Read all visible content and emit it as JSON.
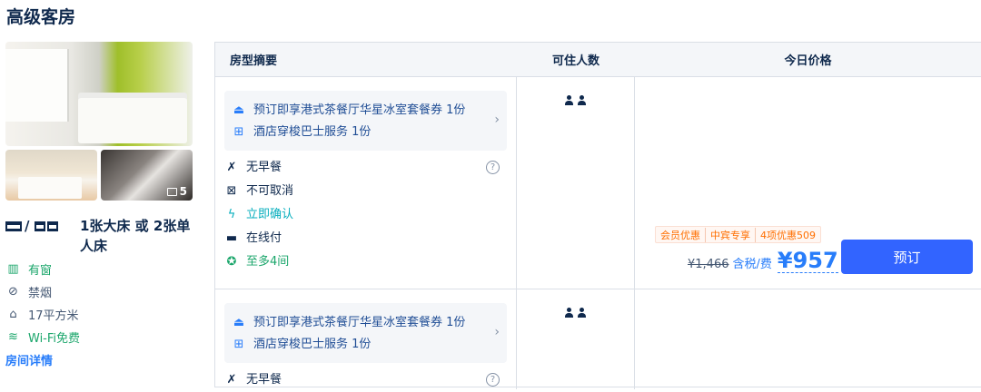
{
  "room": {
    "title": "高级客房",
    "photo_count": "5",
    "bed_sep": "/",
    "bed_text": "1张大床 或 2张单人床",
    "attributes": [
      {
        "icon": "window-icon",
        "text": "有窗"
      },
      {
        "icon": "no-smoking-icon",
        "text": "禁烟"
      },
      {
        "icon": "area-icon",
        "text": "17平方米"
      },
      {
        "icon": "wifi-icon",
        "text": "Wi-Fi免费"
      }
    ],
    "detail_link": "房间详情"
  },
  "table": {
    "headers": [
      "房型摘要",
      "可住人数",
      "今日价格"
    ]
  },
  "rows": [
    {
      "package": [
        "预订即享港式茶餐厅华星冰室套餐券 1份",
        "酒店穿梭巴士服务 1份"
      ],
      "features": [
        "无早餐",
        "不可取消",
        "立即确认",
        "在线付",
        "至多4间"
      ],
      "promo_tags": [
        "会员优惠",
        "中宾专享",
        "4项优惠509"
      ],
      "old_price": "¥1,466",
      "tax_label": "含税/费",
      "price": "¥957",
      "book_label": "预订"
    },
    {
      "package": [
        "预订即享港式茶餐厅华星冰室套餐券 1份",
        "酒店穿梭巴士服务 1份"
      ],
      "features": [
        "无早餐"
      ]
    }
  ],
  "icons": {
    "chevron": "›",
    "help": "?"
  },
  "colors": {
    "accent": "#287dfa",
    "button": "#3264ff",
    "promo": "#ff6f00",
    "green": "#06aebd"
  }
}
